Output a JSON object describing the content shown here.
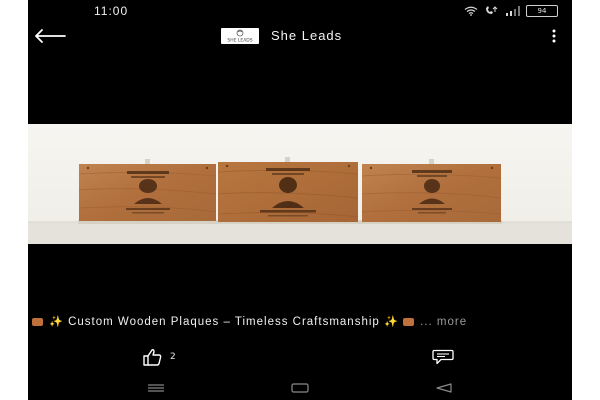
{
  "status_bar": {
    "time": "11:00",
    "battery": "94"
  },
  "header": {
    "title": "She Leads",
    "logo_text": "SHE LEADS"
  },
  "post": {
    "caption": "Custom Wooden Plaques – Timeless Craftsmanship",
    "more_label": "... more",
    "like_count": "2"
  },
  "icons": {
    "status": [
      "wifi-icon",
      "call-icon",
      "signal-icon",
      "battery-icon"
    ],
    "header": [
      "back-arrow-icon",
      "more-vertical-icon"
    ],
    "post": [
      "wood-box-emoji",
      "sparkles-emoji",
      "thumbs-up-icon",
      "comment-icon"
    ],
    "navigation": [
      "recents-icon",
      "home-icon",
      "back-icon"
    ]
  },
  "colors": {
    "background": "#000000",
    "text": "#f0f0f0",
    "muted": "#9a9a9a",
    "wood": "#b5733f",
    "wall": "#f4f3ee"
  }
}
